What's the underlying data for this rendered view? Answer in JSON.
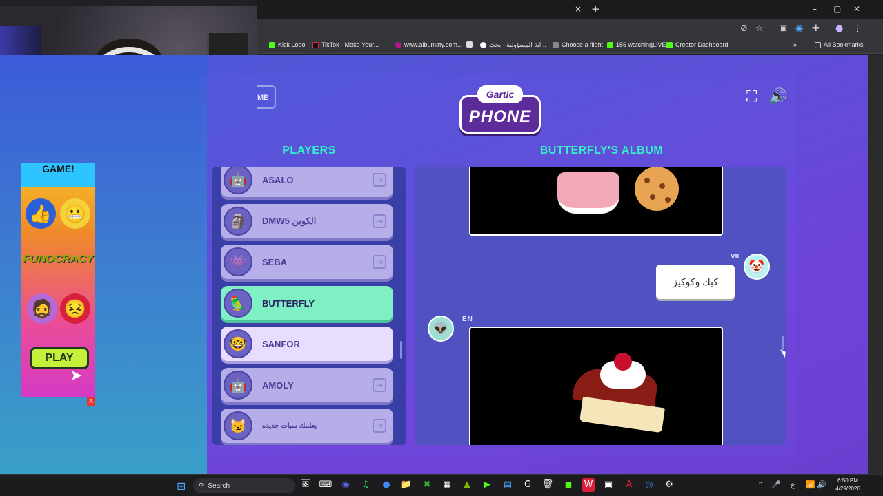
{
  "browser": {
    "tab_close": "×",
    "new_tab": "+",
    "window_controls": [
      "–",
      "▢",
      "✕"
    ],
    "bookmarks": [
      {
        "label": "Kick Logo",
        "color": "#53fc18"
      },
      {
        "label": "TikTok - Make Your...",
        "color": "#111111"
      },
      {
        "label": "www.albumaty.com...",
        "color": "#b5148a"
      },
      {
        "label": "",
        "color": "#dddddd"
      },
      {
        "label": "اية المسؤولية - بحث...",
        "color": "#4285f4"
      },
      {
        "label": "Choose a flight",
        "color": "#888888"
      },
      {
        "label": "156 watchingLIVE",
        "color": "#53fc18"
      },
      {
        "label": "Creator Dashboard",
        "color": "#53fc18"
      }
    ],
    "all_bookmarks": "All Bookmarks",
    "more": "»"
  },
  "game": {
    "home_label": "ME",
    "logo_top": "Gartic",
    "logo_main": "PHONE",
    "fullscreen_icon": "⛶",
    "sound_icon": "🔊",
    "players_title": "PLAYERS",
    "album_title": "BUTTERFLY'S ALBUM",
    "players": [
      {
        "name": "ASALO",
        "icon": "🤖",
        "state": "normal"
      },
      {
        "name": "DMW5 الكوين",
        "icon": "🗿",
        "state": "normal"
      },
      {
        "name": "SEBA",
        "icon": "👾",
        "state": "normal"
      },
      {
        "name": "BUTTERFLY",
        "icon": "🦜",
        "state": "active"
      },
      {
        "name": "SANFOR",
        "icon": "🤓",
        "state": "highlight"
      },
      {
        "name": "AMOLY",
        "icon": "🤖",
        "state": "normal"
      },
      {
        "name": "يعلمك سبات جديده",
        "icon": "😼",
        "state": "normal"
      }
    ],
    "player_action_icon": "⇥",
    "album": {
      "bubble_author": "VII",
      "bubble_text": "كيك وكوكيز",
      "bubble_avatar_icon": "🤡",
      "drawing_author": "EN",
      "drawing_avatar_icon": "👽"
    }
  },
  "ad": {
    "top_text": "GAME!",
    "brand": "FUNOCRACY",
    "play_label": "PLAY",
    "badge": "A"
  },
  "taskbar": {
    "search_label": "Search",
    "start_icon": "⊞",
    "apps": [
      "🖼",
      "⌨",
      "♨",
      "◉",
      "♫",
      "●",
      "📁",
      "✖",
      "▦",
      "▲",
      "▶",
      "▤",
      "G",
      "🗑",
      "◼",
      "W",
      "▣",
      "A",
      "◎",
      "⚙"
    ],
    "tray_icons": [
      "⌃",
      "🎤",
      "ع",
      "📶",
      "🔊",
      "🔋"
    ],
    "time": "6:50 PM",
    "date": "4/29/2026"
  }
}
